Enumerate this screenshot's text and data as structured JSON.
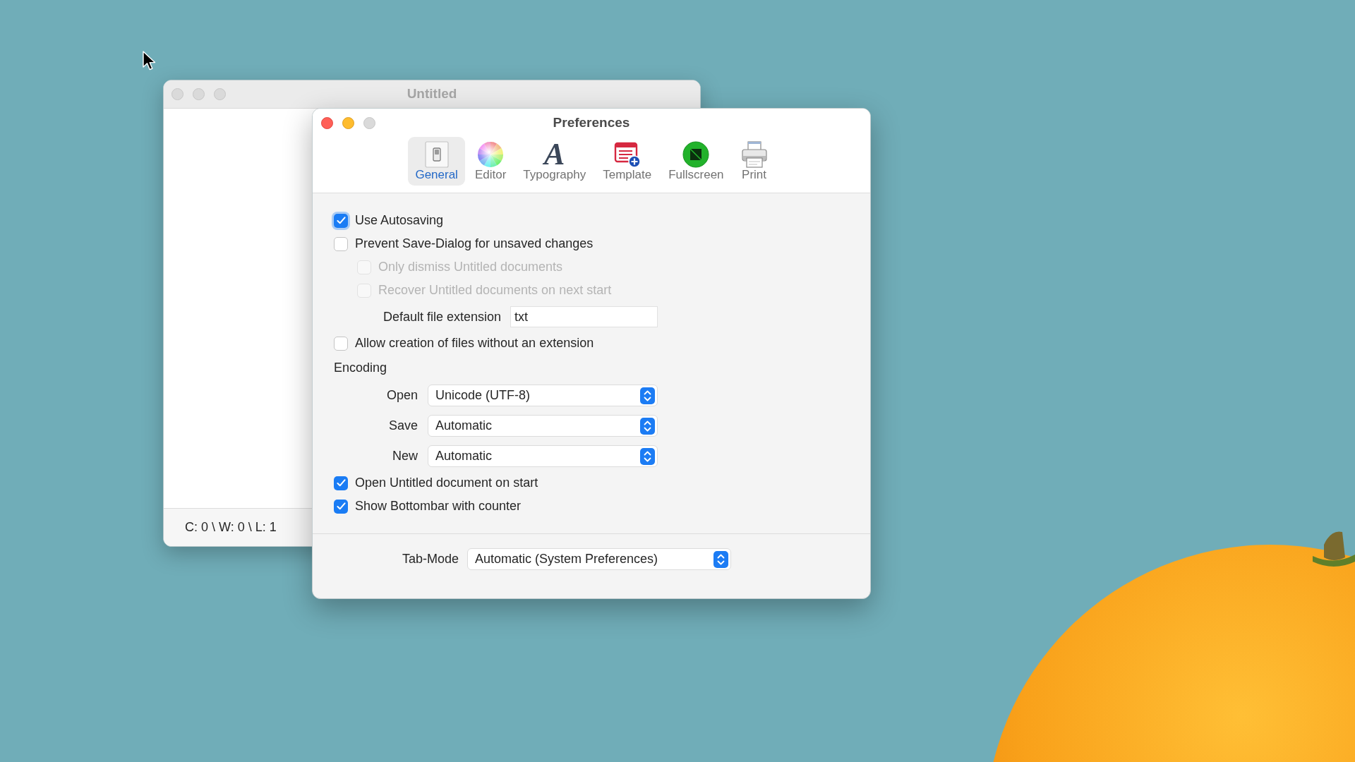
{
  "document_window": {
    "title": "Untitled",
    "active": false,
    "status_bar": "C: 0 \\ W: 0 \\ L: 1"
  },
  "preferences_window": {
    "title": "Preferences",
    "active": true,
    "zoom_enabled": false,
    "tabs": [
      {
        "label": "General",
        "selected": true
      },
      {
        "label": "Editor",
        "selected": false
      },
      {
        "label": "Typography",
        "selected": false,
        "glyph": "A"
      },
      {
        "label": "Template",
        "selected": false
      },
      {
        "label": "Fullscreen",
        "selected": false
      },
      {
        "label": "Print",
        "selected": false
      }
    ],
    "settings": [
      {
        "kind": "checkbox",
        "label": "Use Autosaving",
        "checked": true,
        "disabled": false,
        "focused": true
      },
      {
        "kind": "checkbox",
        "label": "Prevent Save-Dialog for unsaved changes",
        "checked": false,
        "disabled": false,
        "focused": false,
        "children": [
          {
            "kind": "checkbox",
            "label": "Only dismiss Untitled documents",
            "checked": false,
            "disabled": true,
            "focused": false
          },
          {
            "kind": "checkbox",
            "label": "Recover Untitled documents on next start",
            "checked": false,
            "disabled": true,
            "focused": false
          }
        ]
      },
      {
        "kind": "text_field",
        "label": "Default file extension",
        "value": "txt"
      },
      {
        "kind": "checkbox",
        "label": "Allow creation of files without an extension",
        "checked": false,
        "disabled": false,
        "focused": false
      },
      {
        "kind": "heading",
        "label": "Encoding"
      },
      {
        "kind": "select",
        "label": "Open",
        "value": "Unicode (UTF-8)"
      },
      {
        "kind": "select",
        "label": "Save",
        "value": "Automatic"
      },
      {
        "kind": "select",
        "label": "New",
        "value": "Automatic"
      },
      {
        "kind": "checkbox",
        "label": "Open Untitled document on start",
        "checked": true,
        "disabled": false,
        "focused": false
      },
      {
        "kind": "checkbox",
        "label": "Show Bottombar with counter",
        "checked": true,
        "disabled": false,
        "focused": false
      }
    ],
    "footer": {
      "label": "Tab-Mode",
      "value": "Automatic (System Preferences)"
    }
  }
}
